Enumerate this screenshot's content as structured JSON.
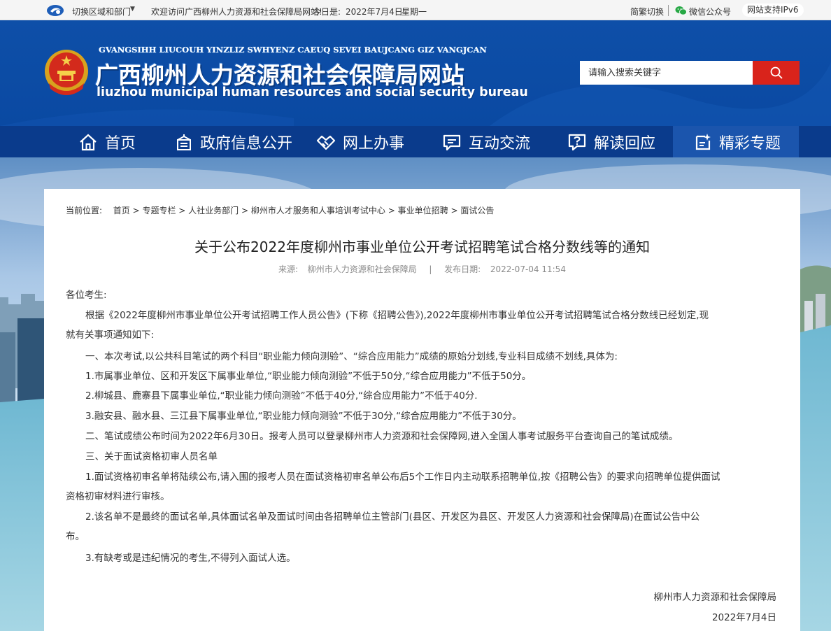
{
  "topbar": {
    "region_label": "切换区域和部门",
    "welcome": "欢迎访问广西柳州人力资源和社会保障局网站!",
    "today_label": "今日是:",
    "date": "2022年7月4日",
    "weekday": "星期一",
    "traditional": "简繁切换",
    "wechat": "微信公众号",
    "ipv6": "网站支持IPv6"
  },
  "header": {
    "pinyin": "GVANGSIHH LIUCOUH YINZLIZ SWHYENZ CAEUQ SEVEI BAUJCANG GIZ VANGJCAN",
    "title": "广西柳州人力资源和社会保障局网站",
    "english": "liuzhou municipal human resources and social security bureau",
    "search_placeholder": "请输入搜索关键字"
  },
  "nav": [
    {
      "label": "首页",
      "icon": "home-icon"
    },
    {
      "label": "政府信息公开",
      "icon": "building-icon"
    },
    {
      "label": "网上办事",
      "icon": "handshake-icon"
    },
    {
      "label": "互动交流",
      "icon": "chat-icon"
    },
    {
      "label": "解读回应",
      "icon": "question-icon"
    },
    {
      "label": "精彩专题",
      "icon": "sparkle-icon"
    }
  ],
  "breadcrumb": {
    "prefix": "当前位置:",
    "items": [
      "首页",
      "专题专栏",
      "人社业务部门",
      "柳州市人才服务和人事培训考试中心",
      "事业单位招聘",
      "面试公告"
    ],
    "separator": ">"
  },
  "article": {
    "title": "关于公布2022年度柳州市事业单位公开考试招聘笔试合格分数线等的通知",
    "source_label": "来源:",
    "source": "柳州市人力资源和社会保障局",
    "divider": "|",
    "date_label": "发布日期:",
    "date": "2022-07-04 11:54",
    "lines": [
      "各位考生:",
      "根据《2022年度柳州市事业单位公开考试招聘工作人员公告》(下称《招聘公告》),2022年度柳州市事业单位公开考试招聘笔试合格分数线已经划定,现",
      "就有关事项通知如下:",
      "一、本次考试,以公共科目笔试的两个科目“职业能力倾向测验”、“综合应用能力”成绩的原始分划线,专业科目成绩不划线,具体为:",
      "1.市属事业单位、区和开发区下属事业单位,“职业能力倾向测验”不低于50分,“综合应用能力”不低于50分。",
      "2.柳城县、鹿寨县下属事业单位,“职业能力倾向测验”不低于40分,“综合应用能力”不低于40分.",
      "3.融安县、融水县、三江县下属事业单位,“职业能力倾向测验”不低于30分,“综合应用能力”不低于30分。",
      "二、笔试成绩公布时间为2022年6月30日。报考人员可以登录柳州市人力资源和社会保障网,进入全国人事考试服务平台查询自己的笔试成绩。",
      "三、关于面试资格初审人员名单",
      "1.面试资格初审名单将陆续公布,请入围的报考人员在面试资格初审名单公布后5个工作日内主动联系招聘单位,按《招聘公告》的要求向招聘单位提供面试",
      "资格初审材料进行审核。",
      "2.该名单不是最终的面试名单,具体面试名单及面试时间由各招聘单位主管部门(县区、开发区为县区、开发区人力资源和社会保障局)在面试公告中公",
      "布。",
      "3.有缺考或是违纪情况的考生,不得列入面试人选。"
    ],
    "signature": "柳州市人力资源和社会保障局",
    "sign_date": "2022年7月4日"
  },
  "colors": {
    "header_blue": "#0e4fa8",
    "nav_blue": "#0a3b8c",
    "nav_active": "#1b55ad",
    "search_red": "#d9231b"
  }
}
